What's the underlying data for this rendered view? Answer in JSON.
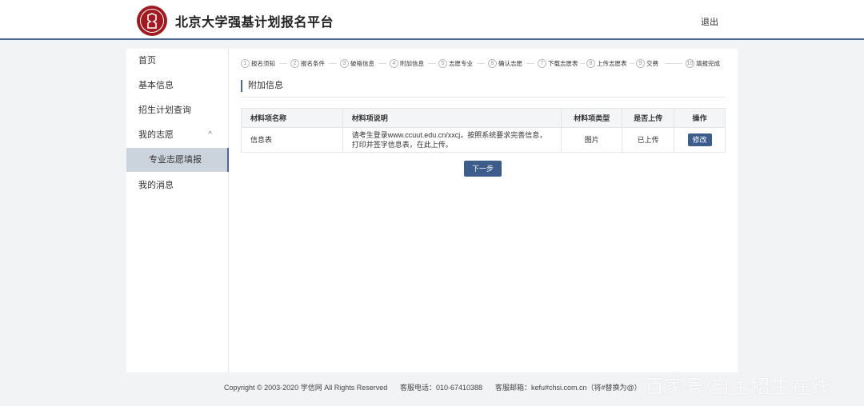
{
  "header": {
    "site_title": "北京大学强基计划报名平台",
    "logout_label": "退出"
  },
  "sidebar": {
    "items": [
      {
        "label": "首页"
      },
      {
        "label": "基本信息"
      },
      {
        "label": "招生计划查询"
      },
      {
        "label": "我的志愿",
        "caret": "^"
      },
      {
        "label": "专业志愿填报"
      },
      {
        "label": "我的消息"
      }
    ]
  },
  "steps": [
    {
      "num": "1",
      "label": "报名须知"
    },
    {
      "num": "2",
      "label": "报名条件"
    },
    {
      "num": "3",
      "label": "破格信息"
    },
    {
      "num": "4",
      "label": "附加信息"
    },
    {
      "num": "5",
      "label": "志愿专业"
    },
    {
      "num": "6",
      "label": "确认志愿"
    },
    {
      "num": "7",
      "label": "下载志愿表"
    },
    {
      "num": "8",
      "label": "上传志愿表"
    },
    {
      "num": "9",
      "label": "交费"
    },
    {
      "num": "10",
      "label": "填报完成"
    }
  ],
  "section": {
    "title": "附加信息"
  },
  "table": {
    "headers": [
      "材料项名称",
      "材料项说明",
      "材料项类型",
      "是否上传",
      "操作"
    ],
    "rows": [
      {
        "name": "信息表",
        "desc_line1": "请考生登录www.ccuut.edu.cn/xxcj，按照系统要求完善信息，",
        "desc_line2": "打印并签字信息表，在此上传。",
        "type": "图片",
        "uploaded": "已上传",
        "action": "修改"
      }
    ]
  },
  "next_button": "下一步",
  "footer": {
    "copyright": "Copyright © 2003-2020 学信网 All Rights Reserved",
    "phone": "客服电话：010-67410388",
    "email": "客服邮箱：kefu#chsi.com.cn（将#替换为@）"
  },
  "watermark": "百家号/自主招生在线",
  "colors": {
    "accent": "#4a6a95",
    "button": "#3c5c8c",
    "brand_red": "#a01a21",
    "success": "#2eaa4a"
  }
}
